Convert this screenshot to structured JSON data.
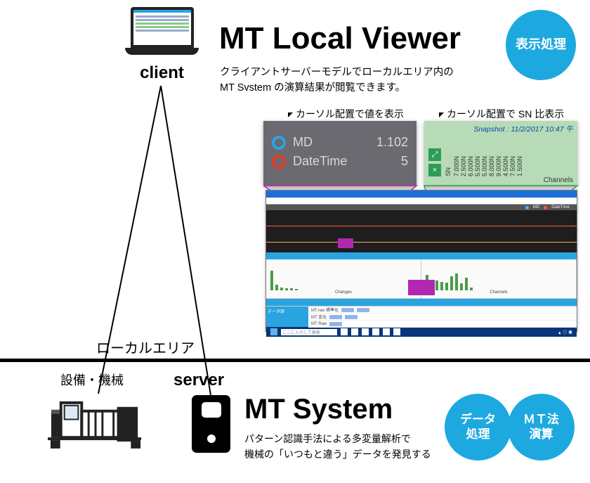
{
  "client": {
    "label": "client"
  },
  "viewer": {
    "title": "MT Local Viewer",
    "badge": "表示処理",
    "sub1": "クライアントサーバーモデルでローカルエリア内の",
    "sub2": "MT Svstem の演算結果が閲覧できます。",
    "callout_left": "カーソル配置で値を表示",
    "callout_right": "カーソル配置で SN 比表示",
    "zoom_grey": {
      "md_label": "MD",
      "md_value": "1.102",
      "dt_label": "DateTime",
      "dt_value": "5"
    },
    "zoom_green": {
      "snapshot": "Snapshot : 11/2/2017 10:47 午",
      "sn_label": "SN",
      "channels_label": "Channels",
      "ticks": [
        "7.000N",
        "2.500N",
        "6.000N",
        "5.500N",
        "5.000N",
        "8.000N",
        "9.000N",
        "4.500N",
        "7.500N",
        "1.500N"
      ],
      "btn1": "⤢",
      "btn2": "×"
    },
    "app": {
      "legend_md": "MD",
      "legend_dt": "DateTime",
      "bluestrip1": "",
      "wp_left_label": "Changes",
      "wp_right_label": "Channels",
      "data_label": "データ部",
      "row1_label": "MT.raw 標準化",
      "row2_label": "MT 変化",
      "row3_label": "MT Raw",
      "search_placeholder": "ここに入力して検索"
    }
  },
  "local_area": {
    "label": "ローカルエリア"
  },
  "server": {
    "equip_label": "設備・機械",
    "label": "server"
  },
  "system": {
    "title": "MT System",
    "sub1": "パターン認識手法による多変量解析で",
    "sub2": "機械の「いつもと違う」データを発見する",
    "badge_data": "データ\n処理",
    "badge_mt": "ＭＴ法\n演算"
  }
}
